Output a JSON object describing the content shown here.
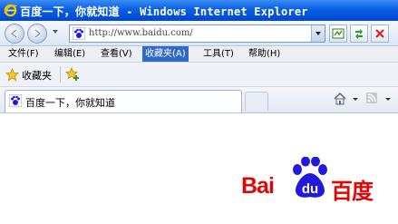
{
  "window": {
    "title": "百度一下，你就知道 - Windows Internet Explorer"
  },
  "navigation": {
    "address": "http://www.baidu.com/",
    "icons": [
      "back-icon",
      "forward-icon",
      "refresh-icon",
      "compat-icon",
      "stop-icon"
    ]
  },
  "menu": {
    "items": [
      {
        "label": "文件(F)"
      },
      {
        "label": "编辑(E)"
      },
      {
        "label": "查看(V)"
      },
      {
        "label": "收藏夹(A)",
        "active": true
      },
      {
        "label": "工具(T)"
      },
      {
        "label": "帮助(H)"
      }
    ]
  },
  "favorites": {
    "label": "收藏夹"
  },
  "tabs": [
    {
      "label": "百度一下，你就知道"
    }
  ],
  "page": {
    "logo_latin": "Bai",
    "logo_du": "du",
    "logo_cn": "百度"
  },
  "colors": {
    "titlebar": "#0a5fe0",
    "menu_active": "#316ac5",
    "baidu_red": "#e10602",
    "baidu_blue": "#2319dc"
  }
}
